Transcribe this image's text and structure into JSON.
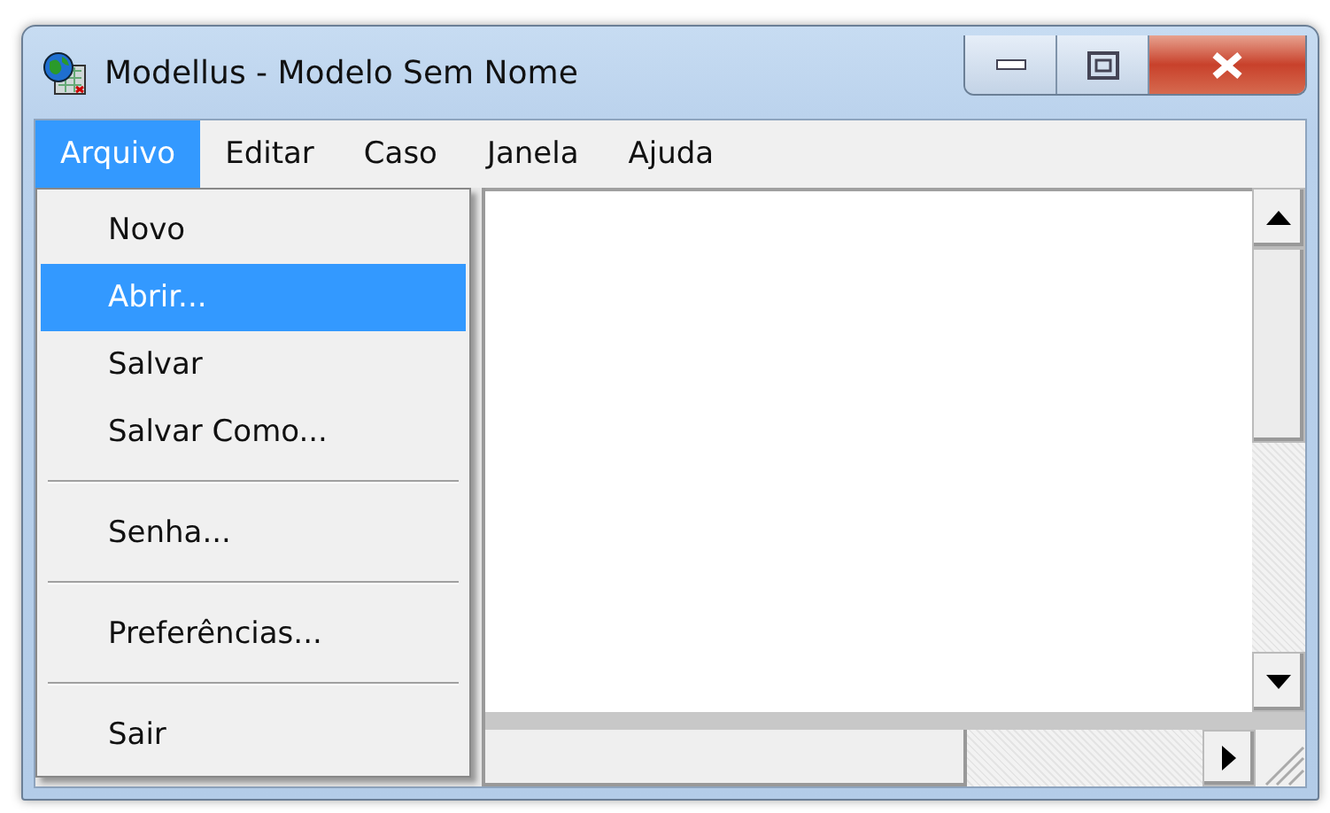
{
  "window": {
    "title": "Modellus - Modelo Sem Nome"
  },
  "menu_bar": [
    {
      "label": "Arquivo",
      "selected": true
    },
    {
      "label": "Editar",
      "selected": false
    },
    {
      "label": "Caso",
      "selected": false
    },
    {
      "label": "Janela",
      "selected": false
    },
    {
      "label": "Ajuda",
      "selected": false
    }
  ],
  "dropdown": [
    {
      "kind": "item",
      "label": "Novo",
      "selected": false
    },
    {
      "kind": "item",
      "label": "Abrir...",
      "selected": true
    },
    {
      "kind": "item",
      "label": "Salvar",
      "selected": false
    },
    {
      "kind": "item",
      "label": "Salvar Como...",
      "selected": false
    },
    {
      "kind": "separator"
    },
    {
      "kind": "item",
      "label": "Senha...",
      "selected": false
    },
    {
      "kind": "separator"
    },
    {
      "kind": "item",
      "label": "Preferências...",
      "selected": false
    },
    {
      "kind": "separator"
    },
    {
      "kind": "item",
      "label": "Sair",
      "selected": false
    }
  ]
}
